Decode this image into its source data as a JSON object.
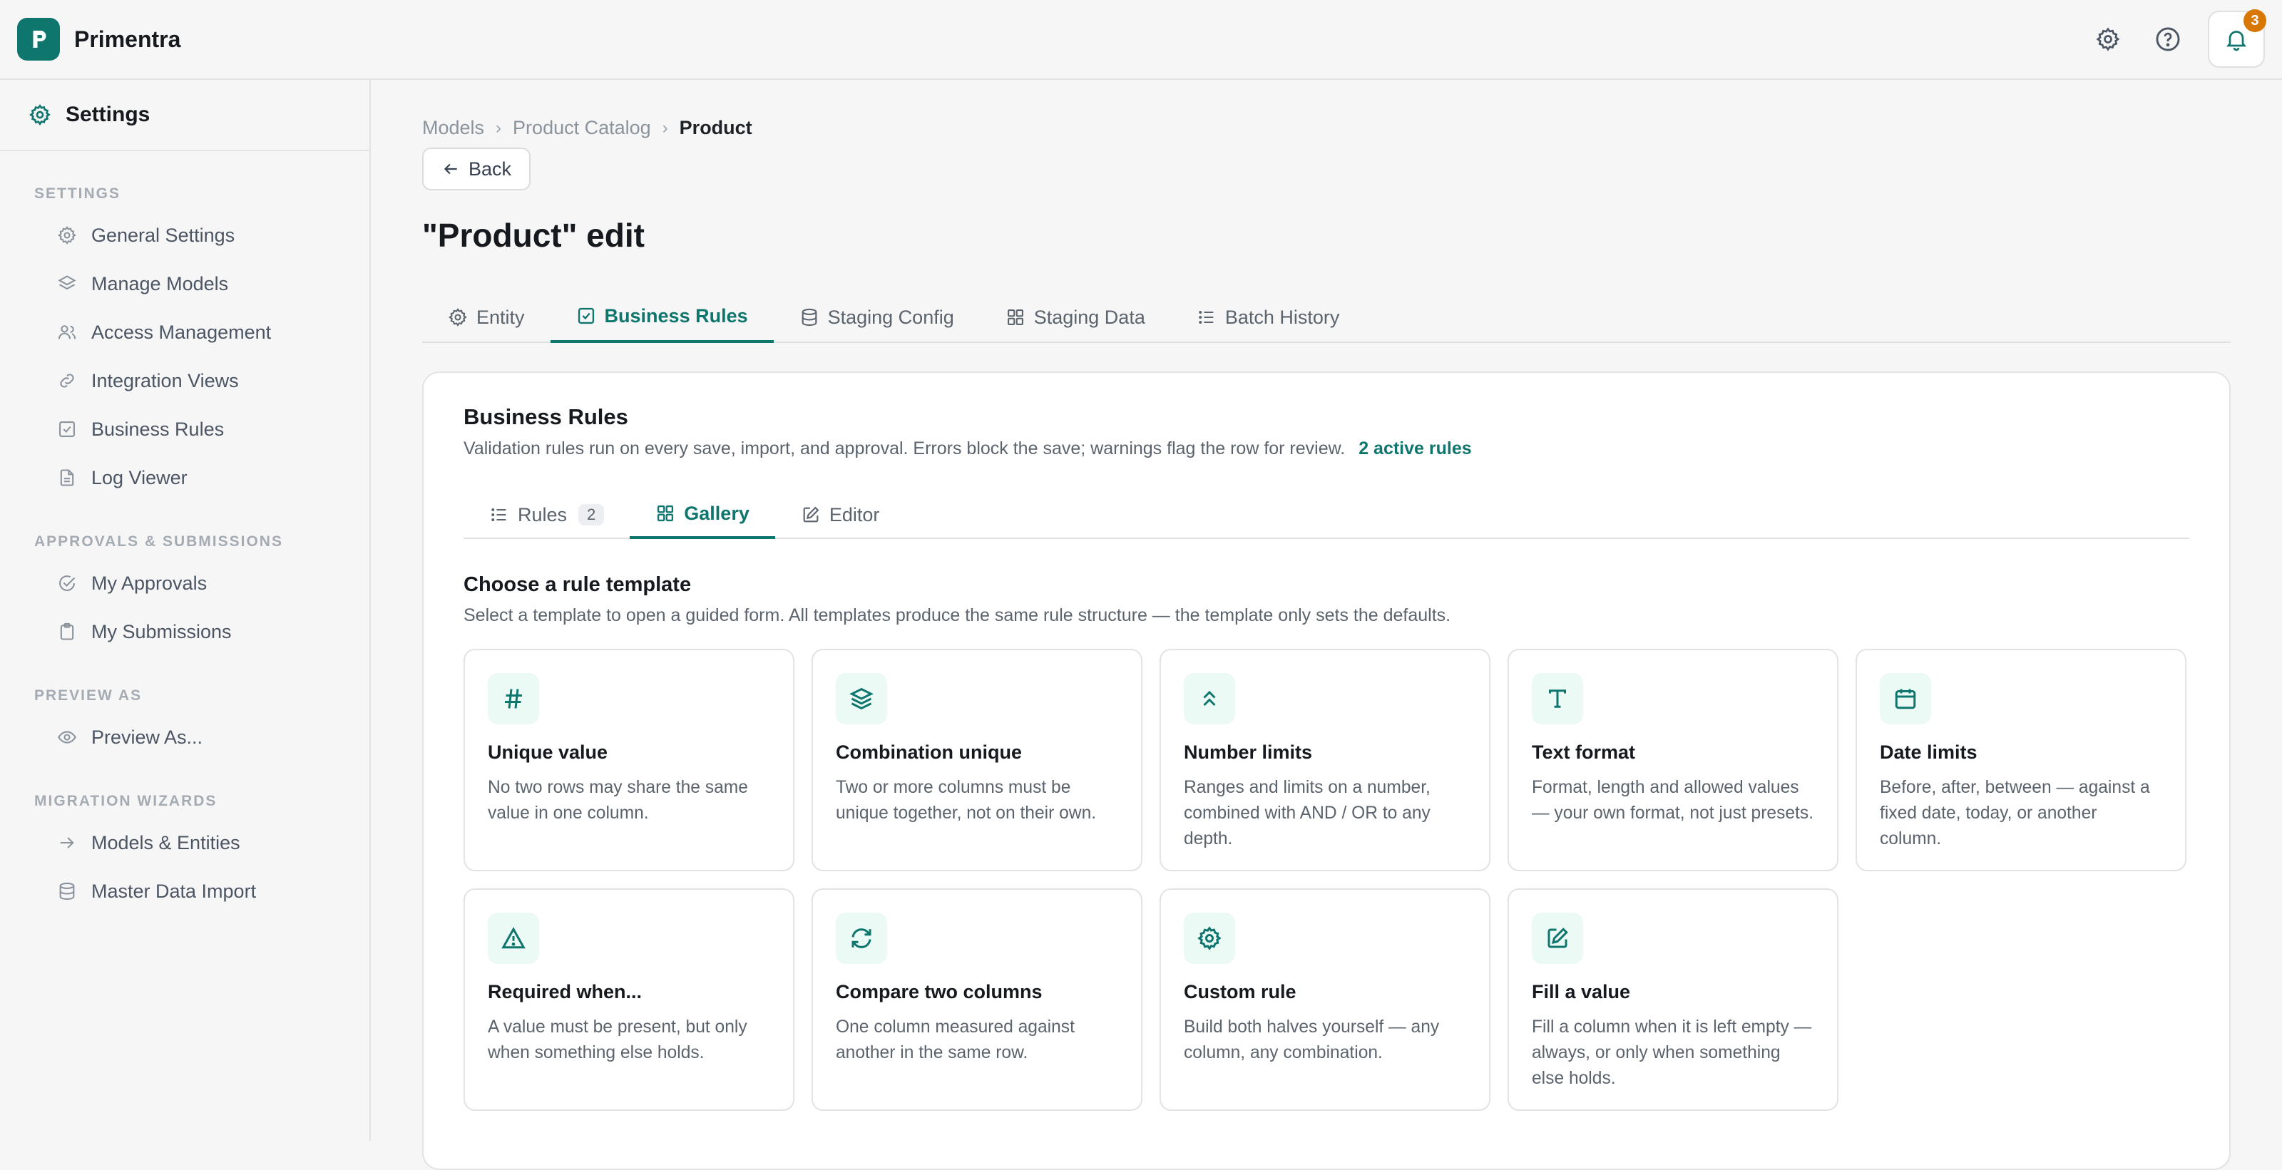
{
  "app": {
    "name": "Primentra",
    "notifications": "3"
  },
  "sidebar": {
    "title": "Settings",
    "sections": [
      {
        "label": "SETTINGS",
        "items": [
          "General Settings",
          "Manage Models",
          "Access Management",
          "Integration Views",
          "Business Rules",
          "Log Viewer"
        ]
      },
      {
        "label": "APPROVALS & SUBMISSIONS",
        "items": [
          "My Approvals",
          "My Submissions"
        ]
      },
      {
        "label": "PREVIEW AS",
        "items": [
          "Preview As..."
        ]
      },
      {
        "label": "MIGRATION WIZARDS",
        "items": [
          "Models & Entities",
          "Master Data Import"
        ]
      }
    ]
  },
  "breadcrumb": {
    "items": [
      "Models",
      "Product Catalog"
    ],
    "current": "Product"
  },
  "back_label": "Back",
  "page_title": "\"Product\" edit",
  "tabs": [
    "Entity",
    "Business Rules",
    "Staging Config",
    "Staging Data",
    "Batch History"
  ],
  "panel": {
    "title": "Business Rules",
    "description": "Validation rules run on every save, import, and approval. Errors block the save; warnings flag the row for review.",
    "active_rules": "2 active rules",
    "subtabs": {
      "rules": "Rules",
      "rules_count": "2",
      "gallery": "Gallery",
      "editor": "Editor"
    },
    "gallery_title": "Choose a rule template",
    "gallery_desc": "Select a template to open a guided form. All templates produce the same rule structure — the template only sets the defaults.",
    "cards": [
      {
        "title": "Unique value",
        "desc": "No two rows may share the same value in one column.",
        "icon": "hash-icon"
      },
      {
        "title": "Combination unique",
        "desc": "Two or more columns must be unique together, not on their own.",
        "icon": "layers-icon"
      },
      {
        "title": "Number limits",
        "desc": "Ranges and limits on a number, combined with AND / OR to any depth.",
        "icon": "chevrons-up-icon"
      },
      {
        "title": "Text format",
        "desc": "Format, length and allowed values — your own format, not just presets.",
        "icon": "type-icon"
      },
      {
        "title": "Date limits",
        "desc": "Before, after, between — against a fixed date, today, or another column.",
        "icon": "calendar-icon"
      },
      {
        "title": "Required when...",
        "desc": "A value must be present, but only when something else holds.",
        "icon": "warning-icon"
      },
      {
        "title": "Compare two columns",
        "desc": "One column measured against another in the same row.",
        "icon": "refresh-icon"
      },
      {
        "title": "Custom rule",
        "desc": "Build both halves yourself — any column, any combination.",
        "icon": "gear-icon"
      },
      {
        "title": "Fill a value",
        "desc": "Fill a column when it is left empty — always, or only when something else holds.",
        "icon": "edit-icon"
      }
    ]
  }
}
